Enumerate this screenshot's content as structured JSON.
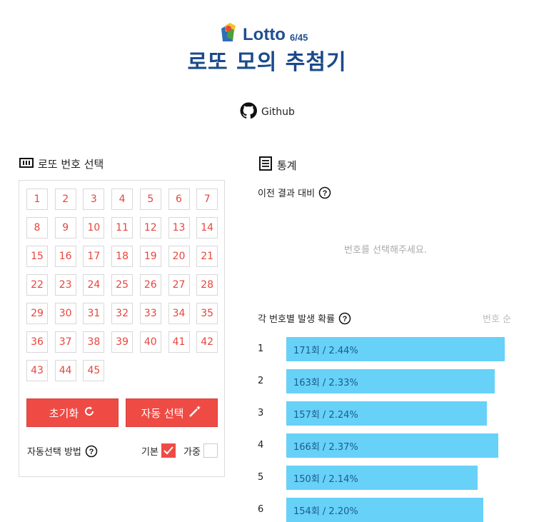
{
  "header": {
    "logo_text": "Lotto",
    "logo_sub": "6/45",
    "title": "로또 모의 추첨기",
    "github_label": "Github"
  },
  "picker": {
    "heading": "로또 번호 선택",
    "numbers": [
      "1",
      "2",
      "3",
      "4",
      "5",
      "6",
      "7",
      "8",
      "9",
      "10",
      "11",
      "12",
      "13",
      "14",
      "15",
      "16",
      "17",
      "18",
      "19",
      "20",
      "21",
      "22",
      "23",
      "24",
      "25",
      "26",
      "27",
      "28",
      "29",
      "30",
      "31",
      "32",
      "33",
      "34",
      "35",
      "36",
      "37",
      "38",
      "39",
      "40",
      "41",
      "42",
      "43",
      "44",
      "45"
    ],
    "reset_label": "초기화",
    "auto_label": "자동 선택",
    "method_label": "자동선택 방법",
    "options": [
      {
        "label": "기본",
        "checked": true
      },
      {
        "label": "가중",
        "checked": false
      }
    ]
  },
  "stats": {
    "heading": "통계",
    "compare_heading": "이전 결과 대비",
    "compare_placeholder": "번호를 선택해주세요.",
    "prob_heading": "각 번호별 발생 확률",
    "sort_label": "번호 순",
    "rows": [
      {
        "num": "1",
        "label": "171회 / 2.44%",
        "share": 2.44
      },
      {
        "num": "2",
        "label": "163회 / 2.33%",
        "share": 2.33
      },
      {
        "num": "3",
        "label": "157회 / 2.24%",
        "share": 2.24
      },
      {
        "num": "4",
        "label": "166회 / 2.37%",
        "share": 2.37
      },
      {
        "num": "5",
        "label": "150회 / 2.14%",
        "share": 2.14
      },
      {
        "num": "6",
        "label": "154회 / 2.20%",
        "share": 2.2
      }
    ]
  },
  "colors": {
    "accent": "#ef4b45",
    "bar": "#67d1f8",
    "title": "#1a4a8a"
  }
}
